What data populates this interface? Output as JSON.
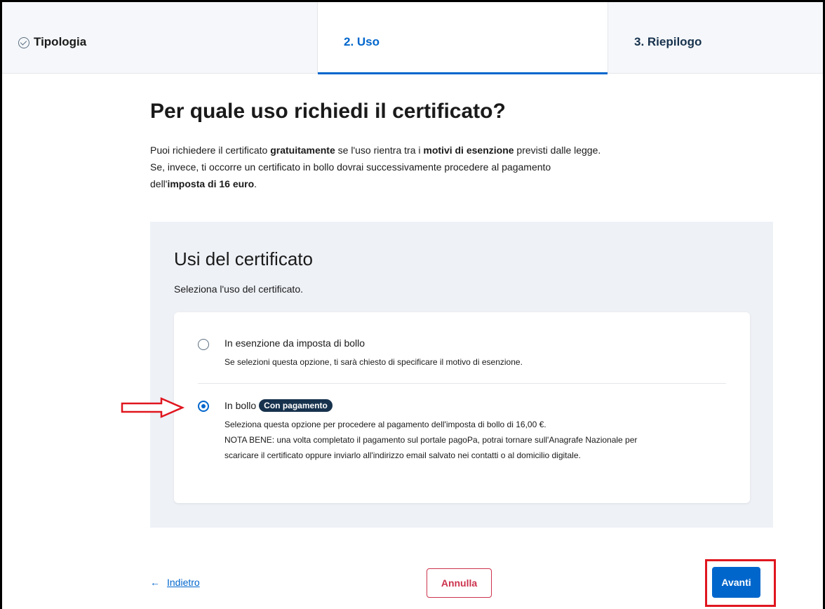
{
  "stepper": {
    "steps": [
      {
        "label": "Tipologia",
        "state": "completed",
        "icon": "check-circle-icon"
      },
      {
        "label": "2. Uso",
        "state": "active"
      },
      {
        "label": "3. Riepilogo",
        "state": "upcoming"
      }
    ]
  },
  "main": {
    "title": "Per quale uso richiedi il certificato?",
    "intro": {
      "line1_a": "Puoi richiedere il certificato ",
      "line1_b": "gratuitamente",
      "line1_c": " se l'uso rientra tra i ",
      "line1_d": "motivi di esenzione",
      "line1_e": " previsti dalle legge.",
      "line2": "Se, invece, ti occorre un certificato in bollo dovrai successivamente procedere al pagamento",
      "line3_a": "dell'",
      "line3_b": "imposta di 16 euro",
      "line3_c": "."
    }
  },
  "panel": {
    "title": "Usi del certificato",
    "subtitle": "Seleziona l'uso del certificato.",
    "options": [
      {
        "label": "In esenzione da imposta di bollo",
        "selected": false,
        "desc": [
          "Se selezioni questa opzione, ti sarà chiesto di specificare il motivo di esenzione."
        ]
      },
      {
        "label": "In bollo",
        "badge": "Con pagamento",
        "selected": true,
        "desc": [
          "Seleziona questa opzione per procedere al pagamento dell'imposta di bollo di 16,00 €.",
          "NOTA BENE: una volta completato il pagamento sul portale pagoPa, potrai tornare sull'Anagrafe Nazionale per",
          "scaricare il certificato oppure inviarlo all'indirizzo email salvato nei contatti o al domicilio digitale."
        ]
      }
    ]
  },
  "footer": {
    "back_arrow": "←",
    "back_label": "Indietro",
    "cancel_label": "Annulla",
    "next_label": "Avanti"
  },
  "colors": {
    "primary": "#0066cc",
    "danger": "#cc334d",
    "annotation": "#e0161f",
    "badge": "#17324d",
    "panel_bg": "#eef1f6"
  }
}
